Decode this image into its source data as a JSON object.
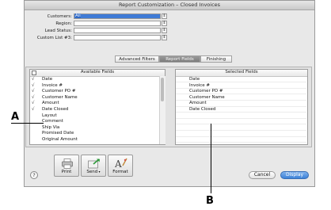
{
  "window": {
    "title": "Report Customization – Closed Invoices"
  },
  "filters": [
    {
      "label": "Customers:",
      "value": "All",
      "selected": true
    },
    {
      "label": "Region:",
      "value": ""
    },
    {
      "label": "Lead Status:",
      "value": ""
    },
    {
      "label": "Custom List #3:",
      "value": ""
    }
  ],
  "tabs": [
    {
      "label": "Advanced Filters",
      "active": false
    },
    {
      "label": "Report Fields",
      "active": true
    },
    {
      "label": "Finishing",
      "active": false
    }
  ],
  "available_fields": {
    "header": "Available Fields",
    "items": [
      {
        "label": "Date",
        "checked": true
      },
      {
        "label": "Invoice #",
        "checked": true
      },
      {
        "label": "Customer PO #",
        "checked": true
      },
      {
        "label": "Customer Name",
        "checked": true
      },
      {
        "label": "Amount",
        "checked": true
      },
      {
        "label": "Date Closed",
        "checked": true
      },
      {
        "label": "Layout",
        "checked": false
      },
      {
        "label": "Comment",
        "checked": false
      },
      {
        "label": "Ship Via",
        "checked": false
      },
      {
        "label": "Promised Date",
        "checked": false
      },
      {
        "label": "Original Amount",
        "checked": false
      }
    ]
  },
  "selected_fields": {
    "header": "Selected Fields",
    "items": [
      "Date",
      "Invoice #",
      "Customer PO #",
      "Customer Name",
      "Amount",
      "Date Closed"
    ]
  },
  "toolbar": {
    "print_label": "Print",
    "send_label": "Send",
    "format_label": "Format",
    "help_label": "?"
  },
  "buttons": {
    "cancel_label": "Cancel",
    "display_label": "Display"
  },
  "callouts": {
    "a": "A",
    "b": "B"
  },
  "check_glyph": "√",
  "colors": {
    "accent": "#3d82d8",
    "active_tab": "#8a8a8a"
  }
}
